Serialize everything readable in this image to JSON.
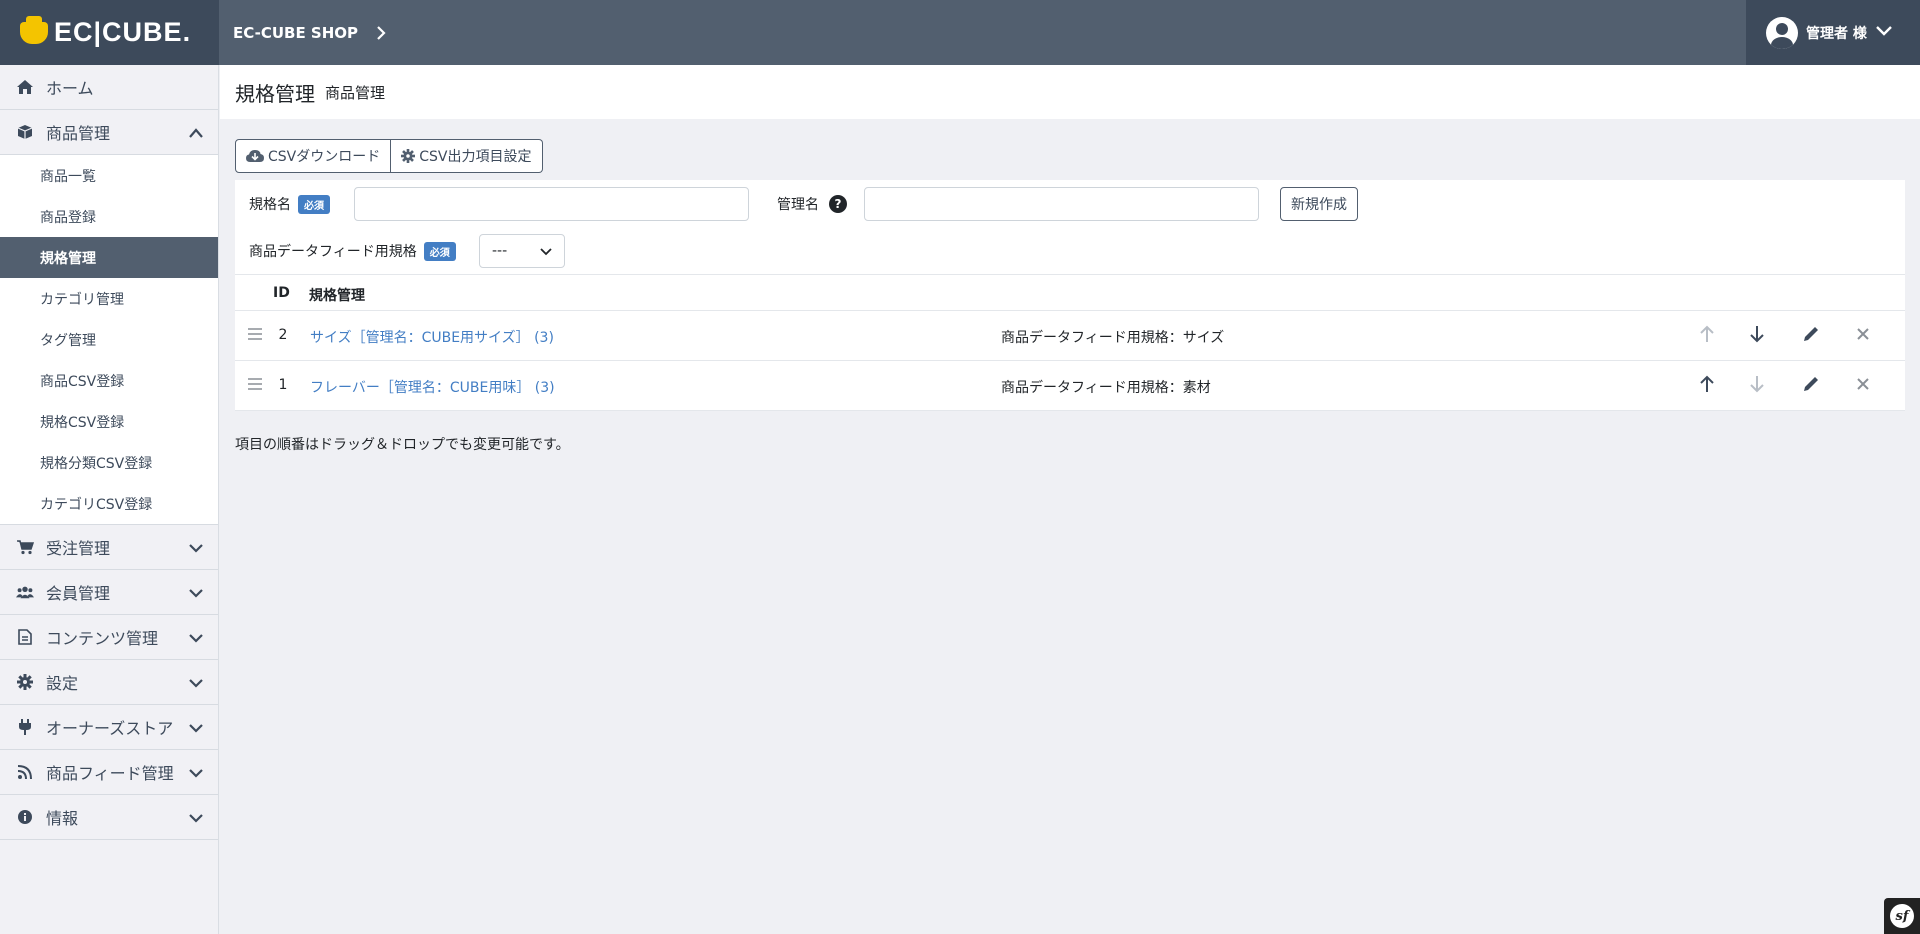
{
  "header": {
    "logo_text": "EC|CUBE.",
    "shop_name": "EC-CUBE SHOP",
    "user_name": "管理者 様"
  },
  "sidebar": {
    "items": [
      {
        "label": "ホーム",
        "icon": "home-icon"
      },
      {
        "label": "商品管理",
        "icon": "box-icon",
        "expanded": true,
        "children": [
          "商品一覧",
          "商品登録",
          "規格管理",
          "カテゴリ管理",
          "タグ管理",
          "商品CSV登録",
          "規格CSV登録",
          "規格分類CSV登録",
          "カテゴリCSV登録"
        ],
        "active_child": "規格管理"
      },
      {
        "label": "受注管理",
        "icon": "cart-icon"
      },
      {
        "label": "会員管理",
        "icon": "users-icon"
      },
      {
        "label": "コンテンツ管理",
        "icon": "file-icon"
      },
      {
        "label": "設定",
        "icon": "gear-icon"
      },
      {
        "label": "オーナーズストア",
        "icon": "plug-icon"
      },
      {
        "label": "商品フィード管理",
        "icon": "rss-icon"
      },
      {
        "label": "情報",
        "icon": "info-icon"
      }
    ]
  },
  "title": {
    "main": "規格管理",
    "sub": "商品管理"
  },
  "toolbar": {
    "csv_download": "CSVダウンロード",
    "csv_settings": "CSV出力項目設定"
  },
  "form": {
    "name_label": "規格名",
    "required": "必須",
    "backend_name_label": "管理名",
    "new_button": "新規作成",
    "feed_label": "商品データフィード用規格",
    "feed_select_value": "---"
  },
  "table": {
    "col_id": "ID",
    "col_name": "規格管理",
    "rows": [
      {
        "id": "2",
        "name": "サイズ［管理名：CUBE用サイズ］ (3)",
        "feed": "商品データフィード用規格：サイズ",
        "up_enabled": false,
        "down_enabled": true
      },
      {
        "id": "1",
        "name": "フレーバー［管理名：CUBE用味］ (3)",
        "feed": "商品データフィード用規格：素材",
        "up_enabled": true,
        "down_enabled": false
      }
    ]
  },
  "help_text": "項目の順番はドラッグ＆ドロップでも変更可能です。",
  "colors": {
    "header": "#525f6f",
    "brand": "#3d4a5b",
    "link": "#437ec4",
    "badge": "#437ec4",
    "logo": "#f4c400"
  }
}
